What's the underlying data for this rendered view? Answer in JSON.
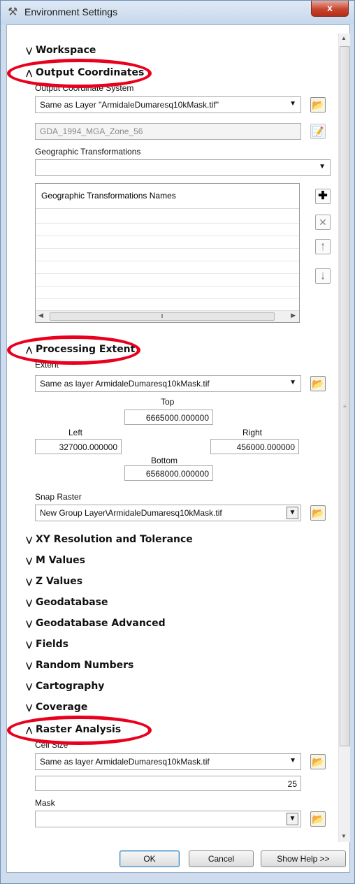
{
  "window": {
    "title": "Environment Settings",
    "close_label": "x"
  },
  "sections": {
    "workspace": "Workspace",
    "output_coordinates": "Output Coordinates",
    "processing_extent": "Processing Extent",
    "xy_resolution": "XY Resolution and Tolerance",
    "m_values": "M Values",
    "z_values": "Z Values",
    "geodatabase": "Geodatabase",
    "geodatabase_advanced": "Geodatabase Advanced",
    "fields": "Fields",
    "random_numbers": "Random Numbers",
    "cartography": "Cartography",
    "coverage": "Coverage",
    "raster_analysis": "Raster Analysis"
  },
  "output_coordinates": {
    "system_label": "Output Coordinate System",
    "system_value": "Same as Layer \"ArmidaleDumaresq10kMask.tif\"",
    "projection_value": "GDA_1994_MGA_Zone_56",
    "transformations_label": "Geographic Transformations",
    "transformations_value": "",
    "grid_header": "Geographic Transformations Names"
  },
  "processing_extent": {
    "extent_label": "Extent",
    "extent_value": "Same as layer ArmidaleDumaresq10kMask.tif",
    "top_label": "Top",
    "top_value": "6665000.000000",
    "left_label": "Left",
    "left_value": "327000.000000",
    "right_label": "Right",
    "right_value": "456000.000000",
    "bottom_label": "Bottom",
    "bottom_value": "6568000.000000",
    "snap_label": "Snap Raster",
    "snap_value": "New Group Layer\\ArmidaleDumaresq10kMask.tif"
  },
  "raster_analysis": {
    "cell_size_label": "Cell Size",
    "cell_size_value": "Same as layer ArmidaleDumaresq10kMask.tif",
    "cell_size_number": "25",
    "mask_label": "Mask",
    "mask_value": ""
  },
  "buttons": {
    "ok": "OK",
    "cancel": "Cancel",
    "help": "Show Help >>"
  },
  "icons": {
    "title": "tools-icon",
    "browse": "folder-open-icon",
    "add": "plus-icon",
    "remove": "x-icon",
    "up": "arrow-up-icon",
    "down": "arrow-down-icon"
  },
  "colors": {
    "annotation": "#e8001c",
    "chrome": "#cfdced"
  }
}
